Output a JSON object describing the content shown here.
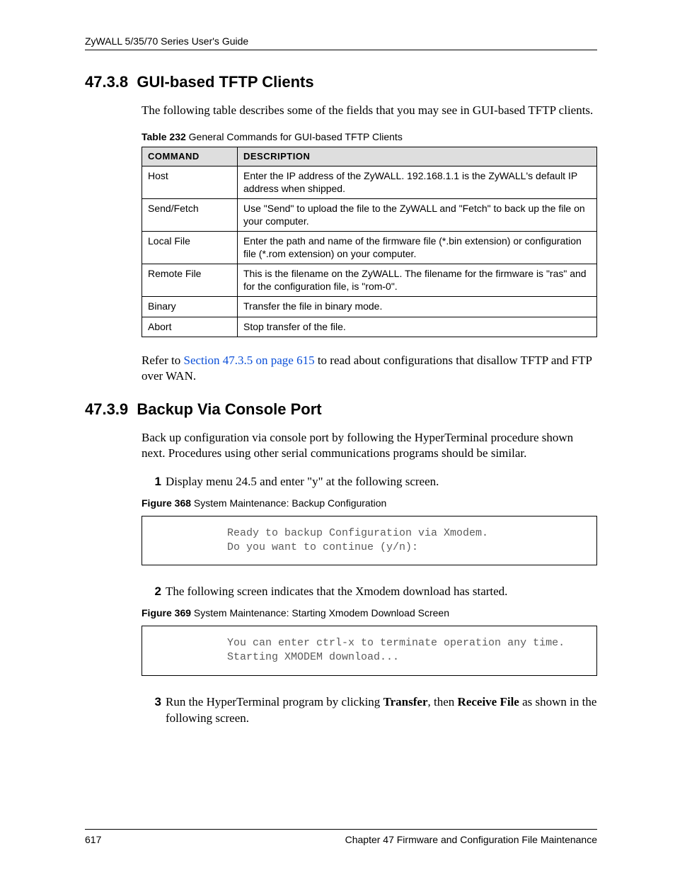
{
  "header": "ZyWALL 5/35/70 Series User's Guide",
  "section1": {
    "number": "47.3.8",
    "title": "GUI-based TFTP Clients",
    "intro": "The following table describes some of the fields that you may see in GUI-based TFTP clients.",
    "table_label_bold": "Table 232",
    "table_label_rest": "   General Commands for GUI-based TFTP Clients",
    "table": {
      "headers": {
        "c1": "COMMAND",
        "c2": "DESCRIPTION"
      },
      "rows": [
        {
          "c1": "Host",
          "c2": "Enter the IP address of the ZyWALL. 192.168.1.1 is the ZyWALL's default IP address when shipped."
        },
        {
          "c1": "Send/Fetch",
          "c2": "Use \"Send\" to upload the file to the ZyWALL and \"Fetch\" to back up the file on your computer."
        },
        {
          "c1": "Local File",
          "c2": "Enter the path and name of the firmware file (*.bin extension) or configuration file (*.rom extension) on your computer."
        },
        {
          "c1": "Remote File",
          "c2": "This is the filename on the ZyWALL. The filename for the firmware is \"ras\" and for the configuration file, is \"rom-0\"."
        },
        {
          "c1": "Binary",
          "c2": "Transfer the file in binary mode."
        },
        {
          "c1": "Abort",
          "c2": "Stop transfer of the file."
        }
      ]
    },
    "refer_pre": "Refer to ",
    "refer_link": "Section 47.3.5 on page 615",
    "refer_post": " to read about configurations that disallow TFTP and FTP over WAN."
  },
  "section2": {
    "number": "47.3.9",
    "title": "Backup Via Console Port",
    "intro": "Back up configuration via console port by following the HyperTerminal procedure shown next. Procedures using other serial communications programs should be similar.",
    "steps": {
      "s1": "Display menu 24.5 and enter \"y\" at the following screen.",
      "s2": "The following screen indicates that the Xmodem download has started.",
      "s3_pre": "Run the HyperTerminal program by clicking ",
      "s3_b1": "Transfer",
      "s3_mid": ", then ",
      "s3_b2": "Receive File",
      "s3_post": " as shown in the following screen."
    },
    "fig368_bold": "Figure 368",
    "fig368_rest": "   System Maintenance: Backup Configuration",
    "term1": "Ready to backup Configuration via Xmodem.\nDo you want to continue (y/n):",
    "fig369_bold": "Figure 369",
    "fig369_rest": "   System Maintenance: Starting Xmodem Download Screen",
    "term2": "You can enter ctrl-x to terminate operation any time.\nStarting XMODEM download..."
  },
  "footer": {
    "page": "617",
    "chapter": "Chapter 47 Firmware and Configuration File Maintenance"
  }
}
